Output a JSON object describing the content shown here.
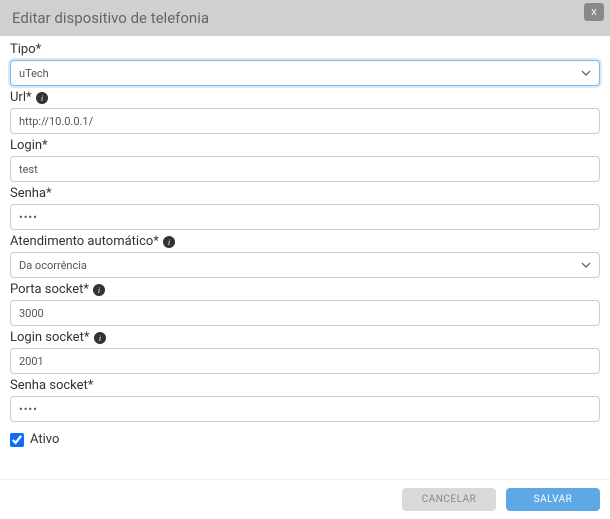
{
  "header": {
    "title": "Editar dispositivo de telefonia",
    "close": "x"
  },
  "fields": {
    "tipo": {
      "label": "Tipo*",
      "value": "uTech"
    },
    "url": {
      "label": "Url*",
      "value": "http://10.0.0.1/"
    },
    "login": {
      "label": "Login*",
      "value": "test"
    },
    "senha": {
      "label": "Senha*",
      "value": "••••"
    },
    "atendimento": {
      "label": "Atendimento automático*",
      "value": "Da ocorrência"
    },
    "porta_socket": {
      "label": "Porta socket*",
      "value": "3000"
    },
    "login_socket": {
      "label": "Login socket*",
      "value": "2001"
    },
    "senha_socket": {
      "label": "Senha socket*",
      "value": "••••"
    },
    "ativo": {
      "label": "Ativo",
      "checked": true
    }
  },
  "footer": {
    "cancel": "CANCELAR",
    "save": "SALVAR"
  }
}
